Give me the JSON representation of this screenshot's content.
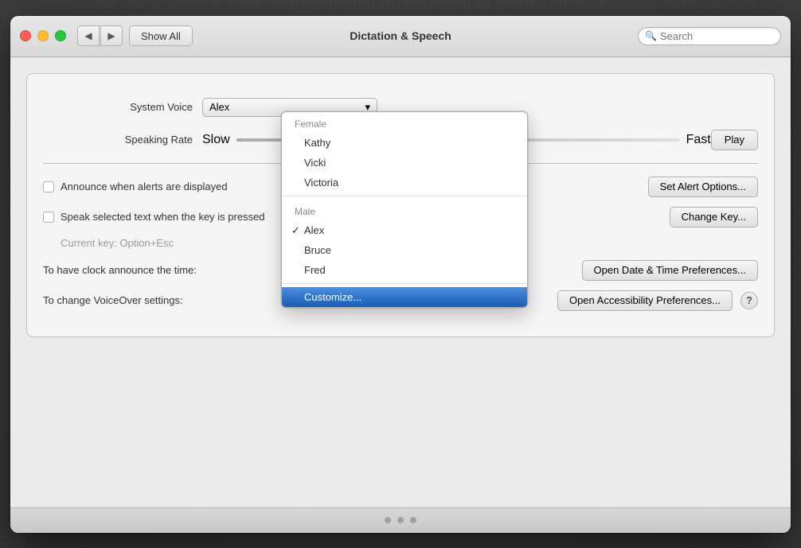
{
  "window": {
    "title": "Dictation & Speech",
    "traffic_lights": {
      "close": "close",
      "minimize": "minimize",
      "maximize": "maximize"
    }
  },
  "toolbar": {
    "back_label": "◀",
    "forward_label": "▶",
    "show_all_label": "Show All",
    "search_placeholder": "Search"
  },
  "voice_section": {
    "system_voice_label": "System Voice",
    "speaking_rate_label": "Speaking Rate",
    "play_label": "Play",
    "slow_label": "Slow",
    "fast_label": "Fast"
  },
  "checkboxes": {
    "announce_alerts_label": "Announce when alerts are displayed",
    "speak_selected_label": "Speak selected text when the key is pressed",
    "set_alert_options_label": "Set Alert Options...",
    "change_key_label": "Change Key...",
    "current_key_label": "Current key: Option+Esc"
  },
  "preferences": {
    "clock_label": "To have clock announce the time:",
    "clock_btn": "Open Date & Time Preferences...",
    "voiceover_label": "To change VoiceOver settings:",
    "voiceover_btn": "Open Accessibility Preferences..."
  },
  "dropdown": {
    "groups": [
      {
        "label": "Female",
        "items": [
          {
            "name": "Kathy",
            "checked": false,
            "selected": false
          },
          {
            "name": "Vicki",
            "checked": false,
            "selected": false
          },
          {
            "name": "Victoria",
            "checked": false,
            "selected": false
          }
        ]
      },
      {
        "label": "Male",
        "items": [
          {
            "name": "Alex",
            "checked": true,
            "selected": false
          },
          {
            "name": "Bruce",
            "checked": false,
            "selected": false
          },
          {
            "name": "Fred",
            "checked": false,
            "selected": false
          }
        ]
      }
    ],
    "customize_label": "Customize..."
  }
}
